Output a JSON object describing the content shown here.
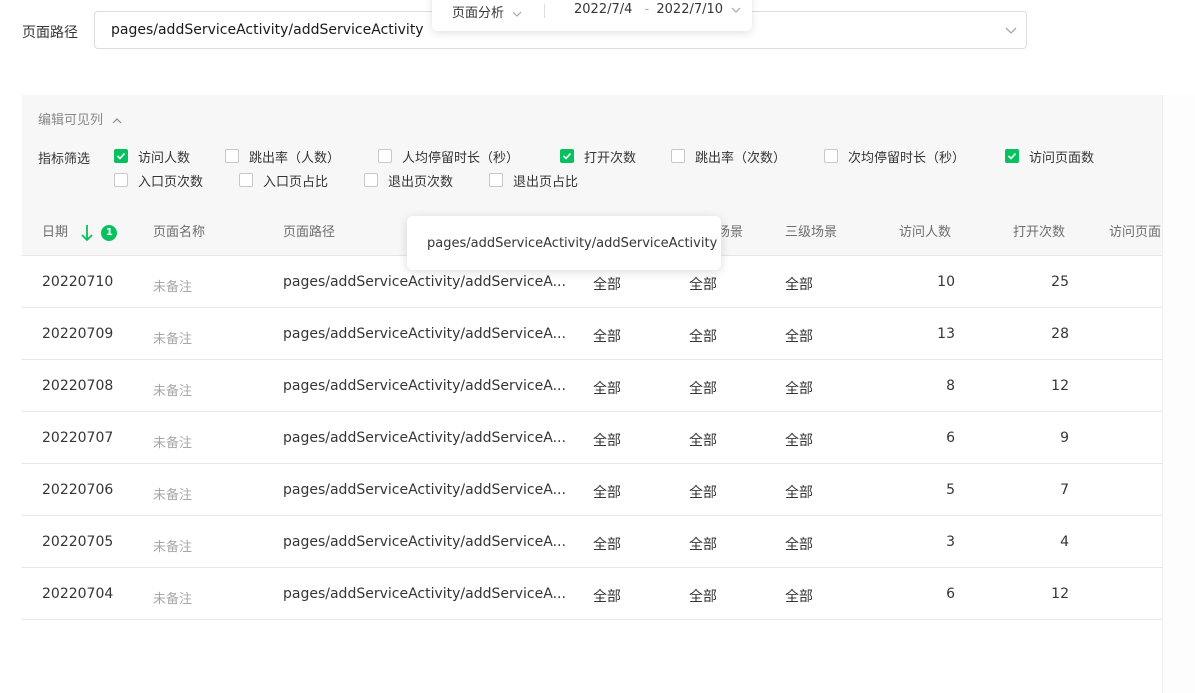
{
  "path_filter": {
    "label": "页面路径",
    "value": "pages/addServiceActivity/addServiceActivity"
  },
  "top_popup": {
    "analysis_label": "页面分析",
    "date_start": "2022/7/4",
    "date_sep": "-",
    "date_end": "2022/7/10"
  },
  "filter_panel": {
    "edit_columns_label": "编辑可见列",
    "metric_filter_label": "指标筛选",
    "checkboxes": [
      {
        "label": "访问人数",
        "checked": true
      },
      {
        "label": "跳出率（人数）",
        "checked": false
      },
      {
        "label": "人均停留时长（秒）",
        "checked": false
      },
      {
        "label": "打开次数",
        "checked": true
      },
      {
        "label": "跳出率（次数）",
        "checked": false
      },
      {
        "label": "次均停留时长（秒）",
        "checked": false
      },
      {
        "label": "访问页面数",
        "checked": true
      },
      {
        "label": "入口页次数",
        "checked": false
      },
      {
        "label": "入口页占比",
        "checked": false
      },
      {
        "label": "退出页次数",
        "checked": false
      },
      {
        "label": "退出页占比",
        "checked": false
      }
    ]
  },
  "table": {
    "headers": {
      "date": "日期",
      "sort_rank": "1",
      "page_name": "页面名称",
      "page_path": "页面路径",
      "scene3_partial": "场景",
      "scene3": "三级场景",
      "visitors": "访问人数",
      "opens": "打开次数",
      "pages_partial": "访问页面"
    },
    "rows": [
      {
        "date": "20220710",
        "name": "未备注",
        "path": "pages/addServiceActivity/addServiceA...",
        "s1": "全部",
        "s2": "全部",
        "s3": "全部",
        "visitors": "10",
        "opens": "25"
      },
      {
        "date": "20220709",
        "name": "未备注",
        "path": "pages/addServiceActivity/addServiceA...",
        "s1": "全部",
        "s2": "全部",
        "s3": "全部",
        "visitors": "13",
        "opens": "28"
      },
      {
        "date": "20220708",
        "name": "未备注",
        "path": "pages/addServiceActivity/addServiceA...",
        "s1": "全部",
        "s2": "全部",
        "s3": "全部",
        "visitors": "8",
        "opens": "12"
      },
      {
        "date": "20220707",
        "name": "未备注",
        "path": "pages/addServiceActivity/addServiceA...",
        "s1": "全部",
        "s2": "全部",
        "s3": "全部",
        "visitors": "6",
        "opens": "9"
      },
      {
        "date": "20220706",
        "name": "未备注",
        "path": "pages/addServiceActivity/addServiceA...",
        "s1": "全部",
        "s2": "全部",
        "s3": "全部",
        "visitors": "5",
        "opens": "7"
      },
      {
        "date": "20220705",
        "name": "未备注",
        "path": "pages/addServiceActivity/addServiceA...",
        "s1": "全部",
        "s2": "全部",
        "s3": "全部",
        "visitors": "3",
        "opens": "4"
      },
      {
        "date": "20220704",
        "name": "未备注",
        "path": "pages/addServiceActivity/addServiceA...",
        "s1": "全部",
        "s2": "全部",
        "s3": "全部",
        "visitors": "6",
        "opens": "12"
      }
    ]
  },
  "tooltip": {
    "text": "pages/addServiceActivity/addServiceActivity"
  },
  "colors": {
    "accent": "#07c160",
    "panel_bg": "#f7f7f7",
    "muted_text": "#a8a8a8"
  }
}
